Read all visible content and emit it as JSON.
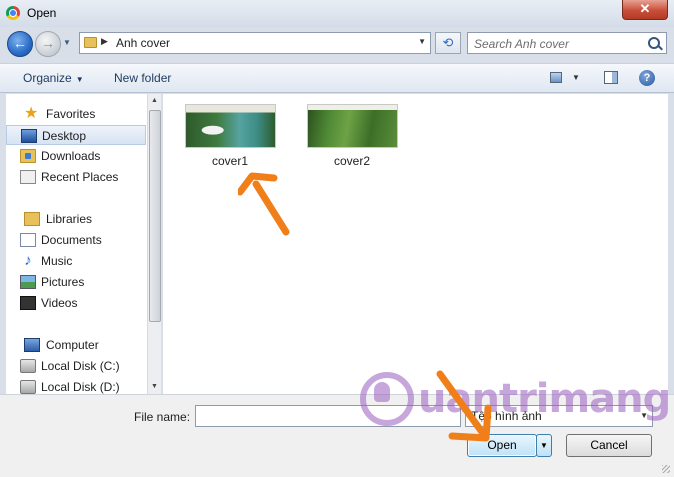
{
  "window": {
    "title": "Open"
  },
  "address": {
    "current_folder": "Anh cover"
  },
  "search": {
    "placeholder": "Search Anh cover"
  },
  "toolbar": {
    "organize_label": "Organize",
    "new_folder_label": "New folder",
    "help_label": "?"
  },
  "nav": {
    "favorites": {
      "label": "Favorites",
      "items": [
        {
          "label": "Desktop",
          "icon": "desktop-icon",
          "selected": true
        },
        {
          "label": "Downloads",
          "icon": "downloads-folder-icon"
        },
        {
          "label": "Recent Places",
          "icon": "recent-places-icon"
        }
      ]
    },
    "libraries": {
      "label": "Libraries",
      "items": [
        {
          "label": "Documents",
          "icon": "documents-icon"
        },
        {
          "label": "Music",
          "icon": "music-icon"
        },
        {
          "label": "Pictures",
          "icon": "pictures-icon"
        },
        {
          "label": "Videos",
          "icon": "videos-icon"
        }
      ]
    },
    "computer": {
      "label": "Computer",
      "items": [
        {
          "label": "Local Disk (C:)",
          "icon": "disk-icon"
        },
        {
          "label": "Local Disk (D:)",
          "icon": "disk-icon"
        }
      ]
    }
  },
  "files": [
    {
      "name": "cover1"
    },
    {
      "name": "cover2"
    }
  ],
  "footer": {
    "file_name_label": "File name:",
    "file_name_value": "",
    "file_type_value": "Tệp hình ảnh",
    "open_label": "Open",
    "cancel_label": "Cancel"
  },
  "watermark": {
    "text": "uantrimang"
  },
  "colors": {
    "annotation_arrow": "#f07f1a",
    "watermark": "#9b5fbf",
    "selection": "#d7e3f3"
  }
}
